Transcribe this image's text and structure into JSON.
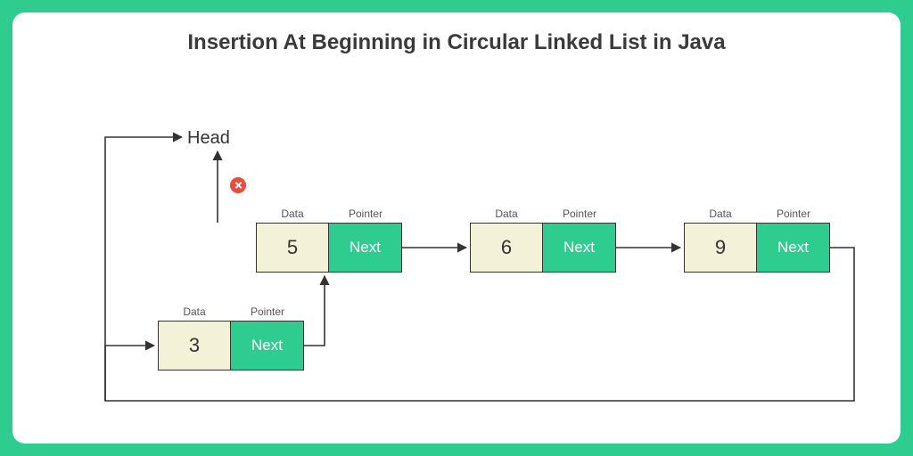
{
  "title": "Insertion At Beginning in Circular Linked List in Java",
  "head_label": "Head",
  "data_col_label": "Data",
  "ptr_col_label": "Pointer",
  "ptr_cell_text": "Next",
  "nodes": {
    "topA": {
      "value": "5"
    },
    "topB": {
      "value": "6"
    },
    "topC": {
      "value": "9"
    },
    "newN": {
      "value": "3"
    }
  },
  "colors": {
    "frame": "#2ECC8F",
    "data_bg": "#F4F1D9",
    "cross": "#E74C3C"
  }
}
